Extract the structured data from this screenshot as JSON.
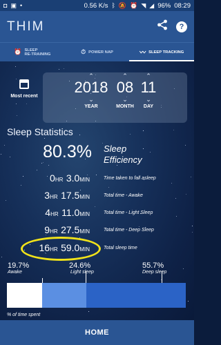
{
  "status_bar": {
    "speed": "0.56 K/s",
    "battery": "96%",
    "time": "08:29"
  },
  "app": {
    "logo": "THIM"
  },
  "tabs": [
    {
      "label_line1": "SLEEP",
      "label_line2": "RE-TRAINING",
      "icon": "alarm-icon",
      "active": false
    },
    {
      "label_line1": "POWER NAP",
      "label_line2": "",
      "icon": "stopwatch-icon",
      "active": false
    },
    {
      "label_line1": "SLEEP TRACKING",
      "label_line2": "",
      "icon": "chart-line-icon",
      "active": true
    }
  ],
  "recent": {
    "label": "Most recent"
  },
  "date": {
    "year": "2018",
    "month": "08",
    "day": "11",
    "year_label": "YEAR",
    "month_label": "MONTH",
    "day_label": "DAY"
  },
  "stats": {
    "title": "Sleep Statistics",
    "efficiency": {
      "value": "80.3%",
      "label_line1": "Sleep",
      "label_line2": "Efficiency"
    },
    "rows": [
      {
        "hours": "0",
        "minutes": "3.0",
        "desc": "Time taken to fall asleep"
      },
      {
        "hours": "3",
        "minutes": "17.5",
        "desc": "Total time - Awake"
      },
      {
        "hours": "4",
        "minutes": "11.0",
        "desc": "Total time - Light Sleep"
      },
      {
        "hours": "9",
        "minutes": "27.5",
        "desc": "Total time - Deep Sleep"
      },
      {
        "hours": "16",
        "minutes": "59.0",
        "desc": "Total sleep time"
      }
    ],
    "hr_unit": "HR",
    "min_unit": "MIN"
  },
  "breakdown": {
    "awake": {
      "pct": "19.7%",
      "label": "Awake",
      "fraction": 0.197
    },
    "light": {
      "pct": "24.6%",
      "label": "Light sleep",
      "fraction": 0.246
    },
    "deep": {
      "pct": "55.7%",
      "label": "Deep sleep",
      "fraction": 0.557
    },
    "footnote": "% of time spent"
  },
  "home": {
    "label": "HOME"
  },
  "colors": {
    "header": "#2a5593",
    "light_sleep": "#5b8fe2",
    "deep_sleep": "#2b63c6",
    "highlight": "#f0e21a"
  }
}
